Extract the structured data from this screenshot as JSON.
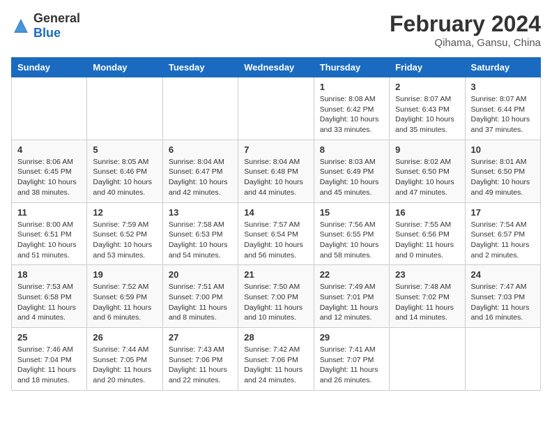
{
  "header": {
    "logo": {
      "general": "General",
      "blue": "Blue"
    },
    "title": "February 2024",
    "subtitle": "Qihama, Gansu, China"
  },
  "calendar": {
    "days_of_week": [
      "Sunday",
      "Monday",
      "Tuesday",
      "Wednesday",
      "Thursday",
      "Friday",
      "Saturday"
    ],
    "weeks": [
      [
        {
          "day": "",
          "info": ""
        },
        {
          "day": "",
          "info": ""
        },
        {
          "day": "",
          "info": ""
        },
        {
          "day": "",
          "info": ""
        },
        {
          "day": "1",
          "info": "Sunrise: 8:08 AM\nSunset: 6:42 PM\nDaylight: 10 hours\nand 33 minutes."
        },
        {
          "day": "2",
          "info": "Sunrise: 8:07 AM\nSunset: 6:43 PM\nDaylight: 10 hours\nand 35 minutes."
        },
        {
          "day": "3",
          "info": "Sunrise: 8:07 AM\nSunset: 6:44 PM\nDaylight: 10 hours\nand 37 minutes."
        }
      ],
      [
        {
          "day": "4",
          "info": "Sunrise: 8:06 AM\nSunset: 6:45 PM\nDaylight: 10 hours\nand 38 minutes."
        },
        {
          "day": "5",
          "info": "Sunrise: 8:05 AM\nSunset: 6:46 PM\nDaylight: 10 hours\nand 40 minutes."
        },
        {
          "day": "6",
          "info": "Sunrise: 8:04 AM\nSunset: 6:47 PM\nDaylight: 10 hours\nand 42 minutes."
        },
        {
          "day": "7",
          "info": "Sunrise: 8:04 AM\nSunset: 6:48 PM\nDaylight: 10 hours\nand 44 minutes."
        },
        {
          "day": "8",
          "info": "Sunrise: 8:03 AM\nSunset: 6:49 PM\nDaylight: 10 hours\nand 45 minutes."
        },
        {
          "day": "9",
          "info": "Sunrise: 8:02 AM\nSunset: 6:50 PM\nDaylight: 10 hours\nand 47 minutes."
        },
        {
          "day": "10",
          "info": "Sunrise: 8:01 AM\nSunset: 6:50 PM\nDaylight: 10 hours\nand 49 minutes."
        }
      ],
      [
        {
          "day": "11",
          "info": "Sunrise: 8:00 AM\nSunset: 6:51 PM\nDaylight: 10 hours\nand 51 minutes."
        },
        {
          "day": "12",
          "info": "Sunrise: 7:59 AM\nSunset: 6:52 PM\nDaylight: 10 hours\nand 53 minutes."
        },
        {
          "day": "13",
          "info": "Sunrise: 7:58 AM\nSunset: 6:53 PM\nDaylight: 10 hours\nand 54 minutes."
        },
        {
          "day": "14",
          "info": "Sunrise: 7:57 AM\nSunset: 6:54 PM\nDaylight: 10 hours\nand 56 minutes."
        },
        {
          "day": "15",
          "info": "Sunrise: 7:56 AM\nSunset: 6:55 PM\nDaylight: 10 hours\nand 58 minutes."
        },
        {
          "day": "16",
          "info": "Sunrise: 7:55 AM\nSunset: 6:56 PM\nDaylight: 11 hours\nand 0 minutes."
        },
        {
          "day": "17",
          "info": "Sunrise: 7:54 AM\nSunset: 6:57 PM\nDaylight: 11 hours\nand 2 minutes."
        }
      ],
      [
        {
          "day": "18",
          "info": "Sunrise: 7:53 AM\nSunset: 6:58 PM\nDaylight: 11 hours\nand 4 minutes."
        },
        {
          "day": "19",
          "info": "Sunrise: 7:52 AM\nSunset: 6:59 PM\nDaylight: 11 hours\nand 6 minutes."
        },
        {
          "day": "20",
          "info": "Sunrise: 7:51 AM\nSunset: 7:00 PM\nDaylight: 11 hours\nand 8 minutes."
        },
        {
          "day": "21",
          "info": "Sunrise: 7:50 AM\nSunset: 7:00 PM\nDaylight: 11 hours\nand 10 minutes."
        },
        {
          "day": "22",
          "info": "Sunrise: 7:49 AM\nSunset: 7:01 PM\nDaylight: 11 hours\nand 12 minutes."
        },
        {
          "day": "23",
          "info": "Sunrise: 7:48 AM\nSunset: 7:02 PM\nDaylight: 11 hours\nand 14 minutes."
        },
        {
          "day": "24",
          "info": "Sunrise: 7:47 AM\nSunset: 7:03 PM\nDaylight: 11 hours\nand 16 minutes."
        }
      ],
      [
        {
          "day": "25",
          "info": "Sunrise: 7:46 AM\nSunset: 7:04 PM\nDaylight: 11 hours\nand 18 minutes."
        },
        {
          "day": "26",
          "info": "Sunrise: 7:44 AM\nSunset: 7:05 PM\nDaylight: 11 hours\nand 20 minutes."
        },
        {
          "day": "27",
          "info": "Sunrise: 7:43 AM\nSunset: 7:06 PM\nDaylight: 11 hours\nand 22 minutes."
        },
        {
          "day": "28",
          "info": "Sunrise: 7:42 AM\nSunset: 7:06 PM\nDaylight: 11 hours\nand 24 minutes."
        },
        {
          "day": "29",
          "info": "Sunrise: 7:41 AM\nSunset: 7:07 PM\nDaylight: 11 hours\nand 26 minutes."
        },
        {
          "day": "",
          "info": ""
        },
        {
          "day": "",
          "info": ""
        }
      ]
    ]
  }
}
